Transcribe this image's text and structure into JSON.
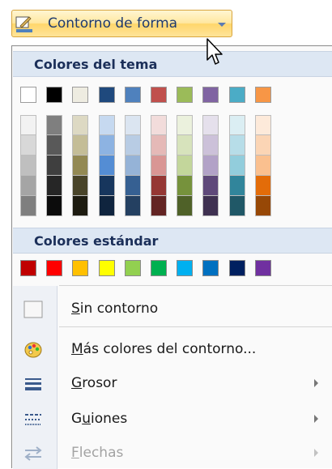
{
  "ribbon": {
    "label": "Contorno de forma",
    "pen_color": "#4f81bd"
  },
  "menu": {
    "theme_header": "Colores del tema",
    "standard_header": "Colores estándar",
    "theme_columns": [
      [
        "#ffffff",
        "#f2f2f2",
        "#d8d8d8",
        "#bfbfbf",
        "#a5a5a5",
        "#7f7f7f"
      ],
      [
        "#000000",
        "#7f7f7f",
        "#595959",
        "#3f3f3f",
        "#262626",
        "#0c0c0c"
      ],
      [
        "#eeece1",
        "#ddd9c3",
        "#c4bd97",
        "#938953",
        "#494429",
        "#1d1b10"
      ],
      [
        "#1f497d",
        "#c6d9f0",
        "#8db3e2",
        "#548dd4",
        "#17365d",
        "#0f243e"
      ],
      [
        "#4f81bd",
        "#dbe5f1",
        "#b8cce4",
        "#95b3d7",
        "#366092",
        "#244061"
      ],
      [
        "#c0504d",
        "#f2dcdb",
        "#e5b9b7",
        "#d99694",
        "#953734",
        "#632423"
      ],
      [
        "#9bbb59",
        "#ebf1dd",
        "#d7e3bc",
        "#c3d69b",
        "#76923c",
        "#4f6128"
      ],
      [
        "#8064a2",
        "#e5e0ec",
        "#ccc1d9",
        "#b2a2c7",
        "#5f497a",
        "#3f3151"
      ],
      [
        "#4bacc6",
        "#dbeef3",
        "#b7dde8",
        "#92cddc",
        "#31859b",
        "#205867"
      ],
      [
        "#f79646",
        "#fdeada",
        "#fbd5b5",
        "#fac08f",
        "#e36c09",
        "#974806"
      ]
    ],
    "standard_colors": [
      "#c00000",
      "#ff0000",
      "#ffc000",
      "#ffff00",
      "#92d050",
      "#00b050",
      "#00b0f0",
      "#0070c0",
      "#002060",
      "#7030a0"
    ],
    "items": [
      {
        "accel": "S",
        "rest": "in contorno",
        "icon": "no-outline-icon",
        "enabled": true,
        "submenu": false
      },
      {
        "accel": "M",
        "rest": "ás colores del contorno...",
        "icon": "color-palette-icon",
        "enabled": true,
        "submenu": false
      },
      {
        "accel": "G",
        "rest": "rosor",
        "icon": "line-weight-icon",
        "enabled": true,
        "submenu": true
      },
      {
        "pre": "G",
        "accel": "u",
        "rest": "iones",
        "icon": "dash-style-icon",
        "enabled": true,
        "submenu": true
      },
      {
        "accel": "F",
        "rest": "lechas",
        "icon": "arrows-icon",
        "enabled": false,
        "submenu": true
      }
    ]
  }
}
